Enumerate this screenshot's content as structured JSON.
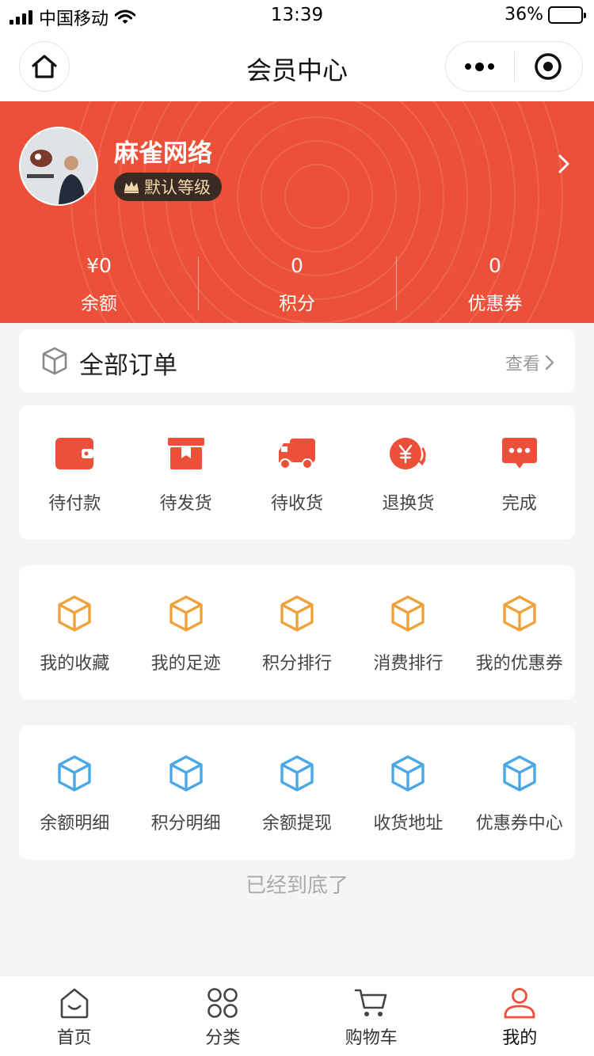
{
  "status_bar": {
    "carrier": "中国移动",
    "time": "13:39",
    "battery": "36%"
  },
  "nav": {
    "title": "会员中心"
  },
  "user": {
    "name": "麻雀网络",
    "level": "默认等级"
  },
  "stats": [
    {
      "value": "¥0",
      "label": "余额"
    },
    {
      "value": "0",
      "label": "积分"
    },
    {
      "value": "0",
      "label": "优惠券"
    }
  ],
  "orders": {
    "title": "全部订单",
    "view_label": "查看"
  },
  "order_status": [
    {
      "label": "待付款",
      "icon": "wallet-icon"
    },
    {
      "label": "待发货",
      "icon": "package-box-icon"
    },
    {
      "label": "待收货",
      "icon": "truck-icon"
    },
    {
      "label": "退换货",
      "icon": "refund-yuan-icon"
    },
    {
      "label": "完成",
      "icon": "chat-bubble-icon"
    }
  ],
  "tools_1": [
    {
      "label": "我的收藏"
    },
    {
      "label": "我的足迹"
    },
    {
      "label": "积分排行"
    },
    {
      "label": "消费排行"
    },
    {
      "label": "我的优惠券"
    }
  ],
  "tools_2": [
    {
      "label": "余额明细"
    },
    {
      "label": "积分明细"
    },
    {
      "label": "余额提现"
    },
    {
      "label": "收货地址"
    },
    {
      "label": "优惠券中心"
    }
  ],
  "bottom_note": "已经到底了",
  "tabs": [
    {
      "label": "首页"
    },
    {
      "label": "分类"
    },
    {
      "label": "购物车"
    },
    {
      "label": "我的"
    }
  ],
  "colors": {
    "accent": "#ec5038",
    "cube_orange": "#f0a23a",
    "cube_blue": "#4aa8e6",
    "battery": "#4cd964"
  }
}
